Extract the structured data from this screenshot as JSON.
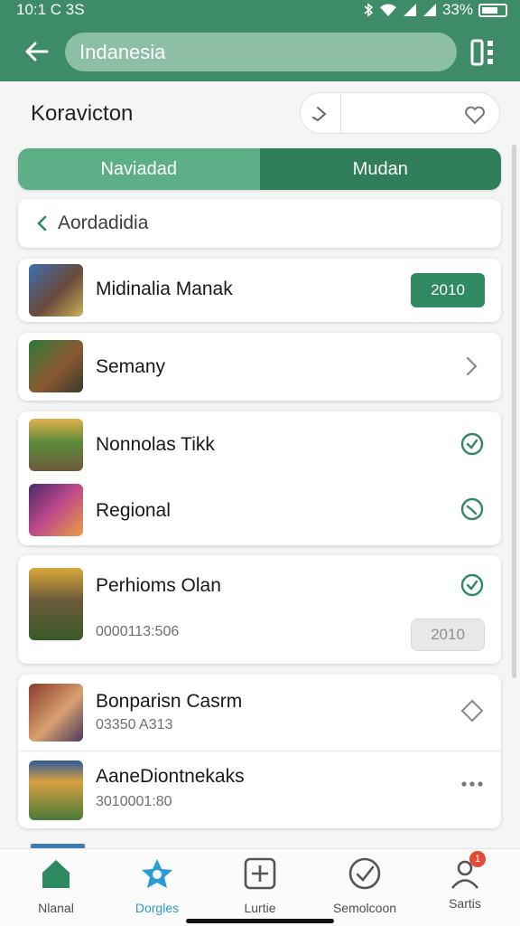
{
  "status": {
    "time": "10:1 C 3S",
    "battery": "33%"
  },
  "header": {
    "search_value": "Indanesia"
  },
  "page": {
    "title": "Koravicton"
  },
  "segments": [
    {
      "label": "Naviadad"
    },
    {
      "label": "Mudan"
    }
  ],
  "breadcrumb": {
    "label": "Aordadidia"
  },
  "items": [
    {
      "name": "Midinalia Manak",
      "action": "2010"
    },
    {
      "name": "Semany"
    },
    {
      "name": "Nonnolas Tikk"
    },
    {
      "name": "Regional"
    },
    {
      "name": "Perhioms Olan",
      "sub": "0000113:506",
      "action": "2010"
    },
    {
      "name": "Bonparisn Casrm",
      "sub": "03350 A313"
    },
    {
      "name": "AaneDiontnekaks",
      "sub": "3010001:80"
    }
  ],
  "nav": [
    {
      "label": "Nlanal",
      "icon": "home-icon"
    },
    {
      "label": "Dorgles",
      "icon": "star-icon"
    },
    {
      "label": "Lurtie",
      "icon": "add-box-icon"
    },
    {
      "label": "Semolcoon",
      "icon": "check-circle-icon"
    },
    {
      "label": "Sartis",
      "icon": "profile-icon",
      "badge": "1"
    }
  ],
  "colors": {
    "primary": "#3d8c67",
    "primary_dark": "#2f7d59",
    "primary_light": "#5eae87",
    "check": "#2f8a62",
    "badge": "#e24b35",
    "nav_active": "#2a9bd4"
  }
}
